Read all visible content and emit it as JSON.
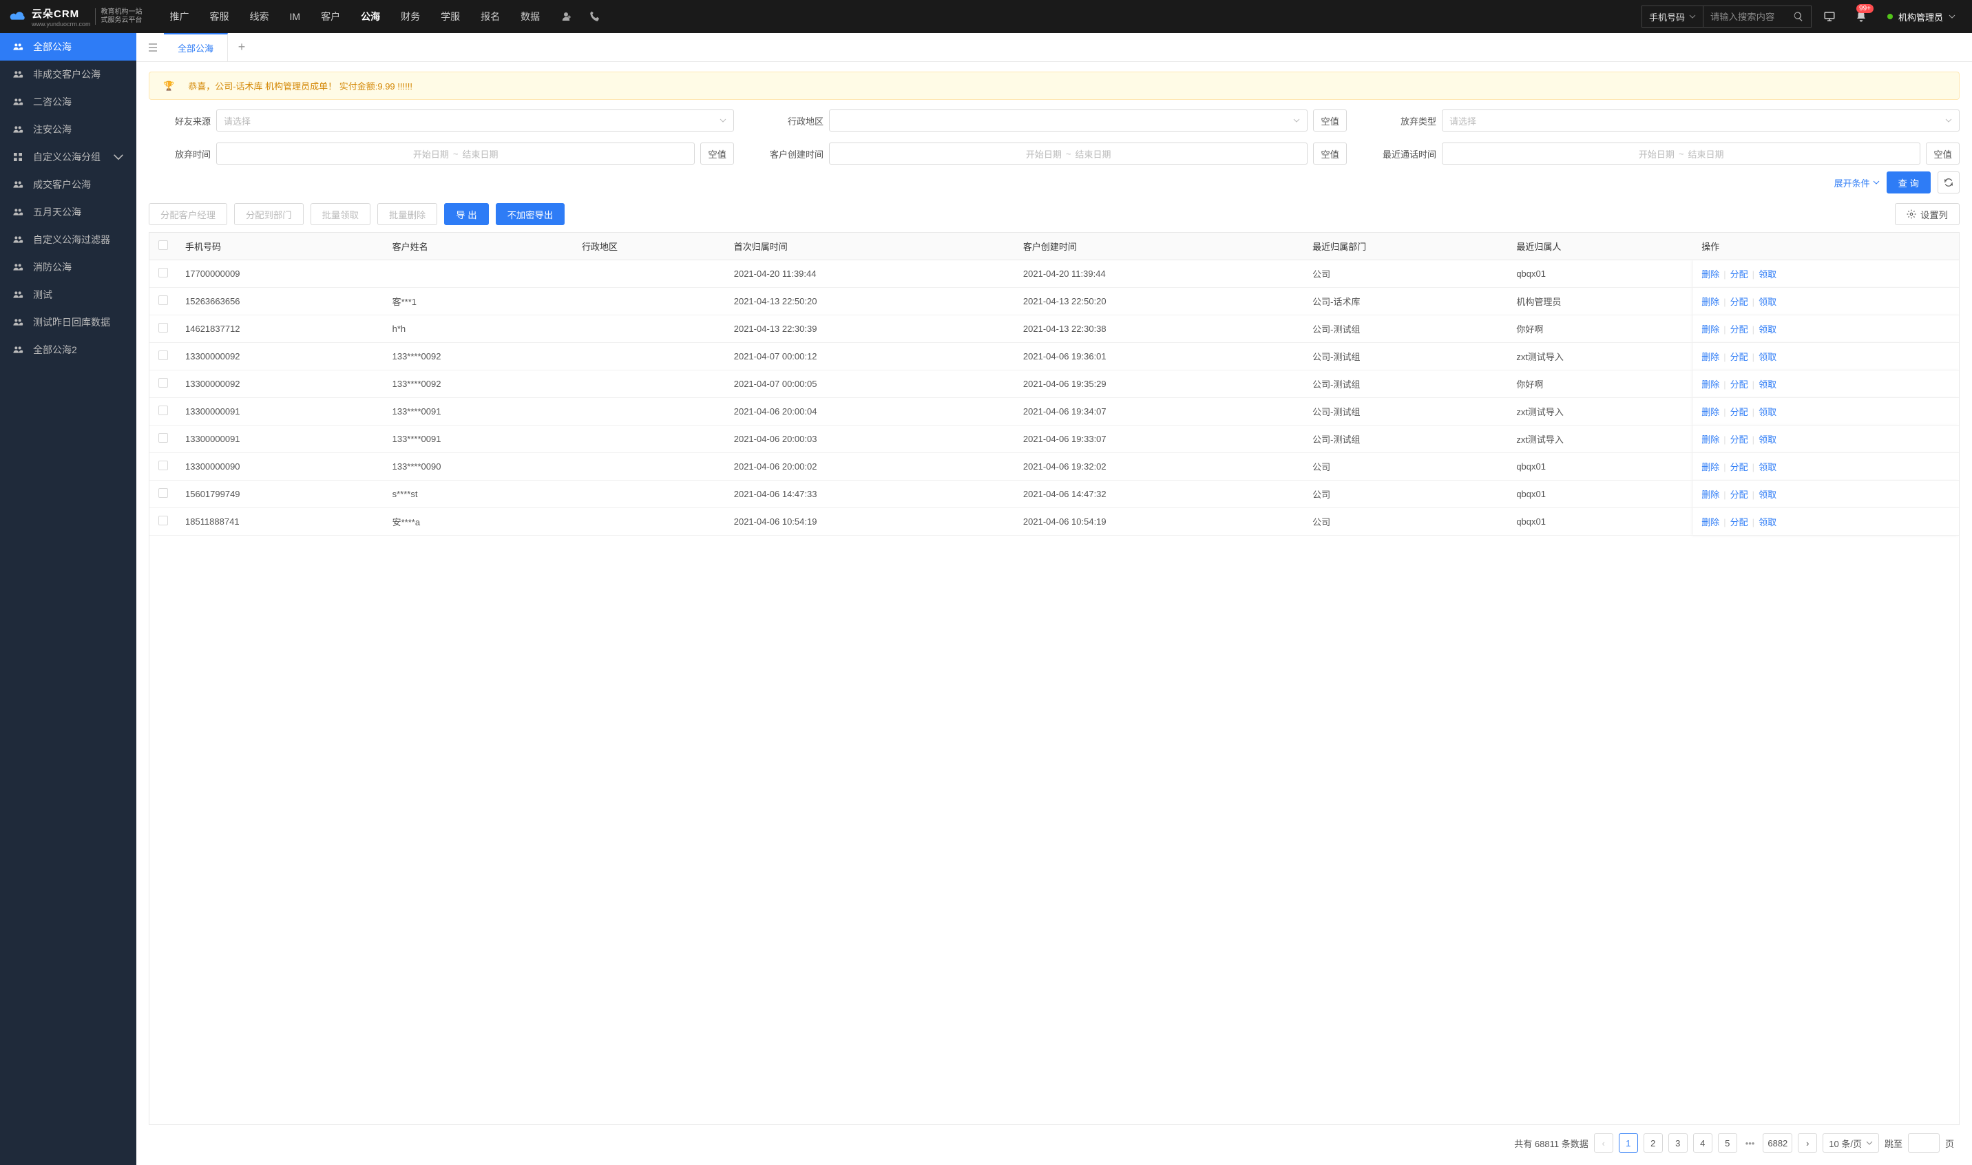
{
  "header": {
    "logo_main": "云朵CRM",
    "logo_sub1": "教育机构一站",
    "logo_sub2": "式服务云平台",
    "logo_url": "www.yunduocrm.com",
    "nav": [
      "推广",
      "客服",
      "线索",
      "IM",
      "客户",
      "公海",
      "财务",
      "学服",
      "报名",
      "数据"
    ],
    "nav_active_index": 5,
    "search_type": "手机号码",
    "search_placeholder": "请输入搜索内容",
    "notif_badge": "99+",
    "user_name": "机构管理员"
  },
  "sidebar": {
    "items": [
      {
        "label": "全部公海",
        "icon": "people"
      },
      {
        "label": "非成交客户公海",
        "icon": "people"
      },
      {
        "label": "二咨公海",
        "icon": "people"
      },
      {
        "label": "注安公海",
        "icon": "people"
      },
      {
        "label": "自定义公海分组",
        "icon": "grid",
        "expandable": true
      },
      {
        "label": "成交客户公海",
        "icon": "people"
      },
      {
        "label": "五月天公海",
        "icon": "people"
      },
      {
        "label": "自定义公海过滤器",
        "icon": "people"
      },
      {
        "label": "消防公海",
        "icon": "people"
      },
      {
        "label": "测试",
        "icon": "people"
      },
      {
        "label": "测试昨日回库数据",
        "icon": "people"
      },
      {
        "label": "全部公海2",
        "icon": "people"
      }
    ],
    "active_index": 0
  },
  "tabs": {
    "items": [
      "全部公海"
    ],
    "active_index": 0
  },
  "banner": "恭喜，公司-话术库  机构管理员成单！  实付金额:9.99 !!!!!!",
  "filters": {
    "friend_source": {
      "label": "好友来源",
      "placeholder": "请选择"
    },
    "region": {
      "label": "行政地区",
      "null_btn": "空值"
    },
    "abandon_type": {
      "label": "放弃类型",
      "placeholder": "请选择"
    },
    "abandon_time": {
      "label": "放弃时间",
      "start": "开始日期",
      "end": "结束日期",
      "null_btn": "空值"
    },
    "create_time": {
      "label": "客户创建时间",
      "start": "开始日期",
      "end": "结束日期",
      "null_btn": "空值"
    },
    "last_call": {
      "label": "最近通话时间",
      "start": "开始日期",
      "end": "结束日期",
      "null_btn": "空值"
    }
  },
  "filter_actions": {
    "expand": "展开条件",
    "query": "查 询"
  },
  "toolbar": {
    "assign_manager": "分配客户经理",
    "assign_dept": "分配到部门",
    "batch_claim": "批量领取",
    "batch_delete": "批量删除",
    "export": "导 出",
    "export_unencrypted": "不加密导出",
    "set_cols": "设置列"
  },
  "table": {
    "columns": [
      "手机号码",
      "客户姓名",
      "行政地区",
      "首次归属时间",
      "客户创建时间",
      "最近归属部门",
      "最近归属人",
      "操作"
    ],
    "ops": {
      "delete": "删除",
      "assign": "分配",
      "claim": "领取"
    },
    "rows": [
      {
        "phone": "17700000009",
        "name": "",
        "region": "",
        "first": "2021-04-20 11:39:44",
        "create": "2021-04-20 11:39:44",
        "dept": "公司",
        "owner": "qbqx01"
      },
      {
        "phone": "15263663656",
        "name": "客***1",
        "region": "",
        "first": "2021-04-13 22:50:20",
        "create": "2021-04-13 22:50:20",
        "dept": "公司-话术库",
        "owner": "机构管理员"
      },
      {
        "phone": "14621837712",
        "name": "h*h",
        "region": "",
        "first": "2021-04-13 22:30:39",
        "create": "2021-04-13 22:30:38",
        "dept": "公司-测试组",
        "owner": "你好啊"
      },
      {
        "phone": "13300000092",
        "name": "133****0092",
        "region": "",
        "first": "2021-04-07 00:00:12",
        "create": "2021-04-06 19:36:01",
        "dept": "公司-测试组",
        "owner": "zxt测试导入"
      },
      {
        "phone": "13300000092",
        "name": "133****0092",
        "region": "",
        "first": "2021-04-07 00:00:05",
        "create": "2021-04-06 19:35:29",
        "dept": "公司-测试组",
        "owner": "你好啊"
      },
      {
        "phone": "13300000091",
        "name": "133****0091",
        "region": "",
        "first": "2021-04-06 20:00:04",
        "create": "2021-04-06 19:34:07",
        "dept": "公司-测试组",
        "owner": "zxt测试导入"
      },
      {
        "phone": "13300000091",
        "name": "133****0091",
        "region": "",
        "first": "2021-04-06 20:00:03",
        "create": "2021-04-06 19:33:07",
        "dept": "公司-测试组",
        "owner": "zxt测试导入"
      },
      {
        "phone": "13300000090",
        "name": "133****0090",
        "region": "",
        "first": "2021-04-06 20:00:02",
        "create": "2021-04-06 19:32:02",
        "dept": "公司",
        "owner": "qbqx01"
      },
      {
        "phone": "15601799749",
        "name": "s****st",
        "region": "",
        "first": "2021-04-06 14:47:33",
        "create": "2021-04-06 14:47:32",
        "dept": "公司",
        "owner": "qbqx01"
      },
      {
        "phone": "18511888741",
        "name": "安****a",
        "region": "",
        "first": "2021-04-06 10:54:19",
        "create": "2021-04-06 10:54:19",
        "dept": "公司",
        "owner": "qbqx01"
      }
    ]
  },
  "pagination": {
    "total_prefix": "共有",
    "total": "68811",
    "total_suffix": "条数据",
    "pages": [
      "1",
      "2",
      "3",
      "4",
      "5"
    ],
    "last": "6882",
    "size_label": "10 条/页",
    "jump_prefix": "跳至",
    "jump_suffix": "页"
  }
}
